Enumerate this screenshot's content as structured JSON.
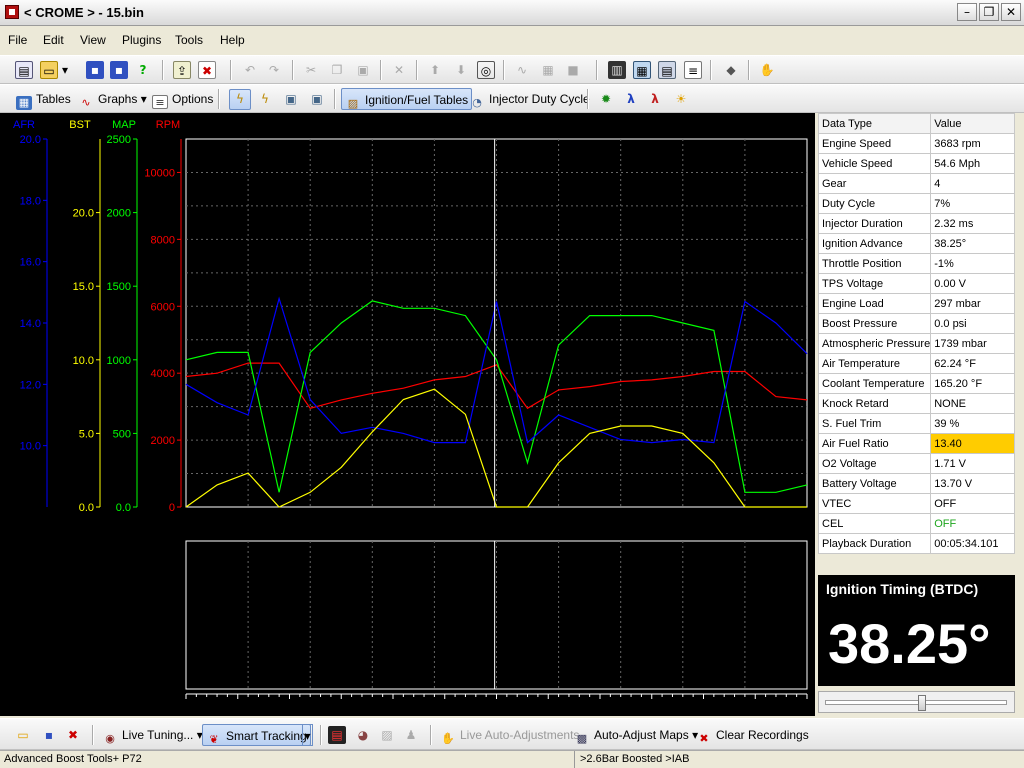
{
  "window": {
    "title": "< CROME > - 15.bin"
  },
  "menu": [
    "File",
    "Edit",
    "View",
    "Plugins",
    "Tools",
    "Help"
  ],
  "toolbar2": {
    "tables": "Tables",
    "graphs": "Graphs",
    "options": "Options",
    "ignition_fuel_tables": "Ignition/Fuel Tables",
    "injector_duty_cycle": "Injector Duty Cycle"
  },
  "chart_data": {
    "type": "line",
    "axes": [
      {
        "name": "AFR",
        "color": "#0000ff",
        "range": [
          8.0,
          20.0
        ],
        "ticks": [
          "20.0",
          "18.0",
          "16.0",
          "14.0",
          "12.0",
          "10.0"
        ]
      },
      {
        "name": "BST",
        "color": "#ffff00",
        "range": [
          0.0,
          25.0
        ],
        "ticks": [
          "20.0",
          "15.0",
          "10.0",
          "5.0",
          "0.0"
        ]
      },
      {
        "name": "MAP",
        "color": "#00ff00",
        "range": [
          0,
          2500
        ],
        "ticks": [
          "2500",
          "2000",
          "1500",
          "1000",
          "500",
          "0.0"
        ]
      },
      {
        "name": "RPM",
        "color": "#ff0000",
        "range": [
          0,
          11000
        ],
        "ticks": [
          "10000",
          "8000",
          "6000",
          "4000",
          "2000",
          "0"
        ]
      }
    ],
    "grid": true,
    "x_samples": 21,
    "series": [
      {
        "name": "RPM",
        "color": "#ff0000",
        "axis": 3,
        "values": [
          3900,
          4000,
          4300,
          4300,
          2950,
          3200,
          3400,
          3550,
          3800,
          3900,
          4250,
          2950,
          3500,
          3600,
          3750,
          3800,
          3900,
          4050,
          4050,
          3300,
          3200
        ]
      },
      {
        "name": "MAP",
        "color": "#00ff00",
        "axis": 2,
        "values": [
          1000,
          1050,
          1050,
          100,
          1050,
          1250,
          1400,
          1350,
          1350,
          1300,
          1000,
          300,
          1100,
          1300,
          1300,
          1300,
          1250,
          1200,
          100,
          100,
          150
        ]
      },
      {
        "name": "AFR",
        "color": "#0000ff",
        "axis": 0,
        "values": [
          12.0,
          11.4,
          11.0,
          14.8,
          11.5,
          10.4,
          10.6,
          10.4,
          10.1,
          10.1,
          14.7,
          10.1,
          11.0,
          10.6,
          10.2,
          10.1,
          10.2,
          10.1,
          14.7,
          14.0,
          13.0
        ]
      },
      {
        "name": "BST",
        "color": "#ffff00",
        "axis": 1,
        "values": [
          0.0,
          1.5,
          2.3,
          0.0,
          1.0,
          2.7,
          5.1,
          7.3,
          8.0,
          6.3,
          0.0,
          0.0,
          3.0,
          5.0,
          5.5,
          5.5,
          5.0,
          3.0,
          0.0,
          0.0,
          0.0
        ]
      }
    ]
  },
  "data_table": {
    "headers": [
      "Data Type",
      "Value"
    ],
    "rows": [
      [
        "Engine Speed",
        "3683 rpm"
      ],
      [
        "Vehicle Speed",
        "54.6 Mph"
      ],
      [
        "Gear",
        "4"
      ],
      [
        "Duty Cycle",
        "7%"
      ],
      [
        "Injector Duration",
        "2.32 ms"
      ],
      [
        "Ignition Advance",
        "38.25°"
      ],
      [
        "Throttle Position",
        "-1%"
      ],
      [
        "TPS Voltage",
        "0.00 V"
      ],
      [
        "Engine Load",
        "297 mbar"
      ],
      [
        "Boost Pressure",
        "0.0 psi"
      ],
      [
        "Atmospheric Pressure",
        "1739 mbar"
      ],
      [
        "Air Temperature",
        "62.24 °F"
      ],
      [
        "Coolant Temperature",
        "165.20 °F"
      ],
      [
        "Knock Retard",
        "NONE"
      ],
      [
        "S. Fuel Trim",
        "39 %"
      ],
      [
        "Air Fuel Ratio",
        "13.40"
      ],
      [
        "O2 Voltage",
        "1.71 V"
      ],
      [
        "Battery Voltage",
        "13.70 V"
      ],
      [
        "VTEC",
        "OFF"
      ],
      [
        "CEL",
        "OFF"
      ],
      [
        "Playback Duration",
        "00:05:34.101"
      ]
    ],
    "highlight_color": "#ffcc00"
  },
  "big_display": {
    "title": "Ignition Timing (BTDC)",
    "value": "38.25°"
  },
  "playback_slider": {
    "position": 0.53
  },
  "bottom_toolbar": {
    "live_tuning": "Live Tuning...",
    "smart_tracking": "Smart Tracking",
    "live_auto_adjustments": "Live Auto-Adjustments",
    "auto_adjust_maps": "Auto-Adjust Maps",
    "clear_recordings": "Clear Recordings"
  },
  "status": {
    "left": "Advanced Boost Tools+ P72",
    "right": ">2.6Bar Boosted >IAB"
  }
}
